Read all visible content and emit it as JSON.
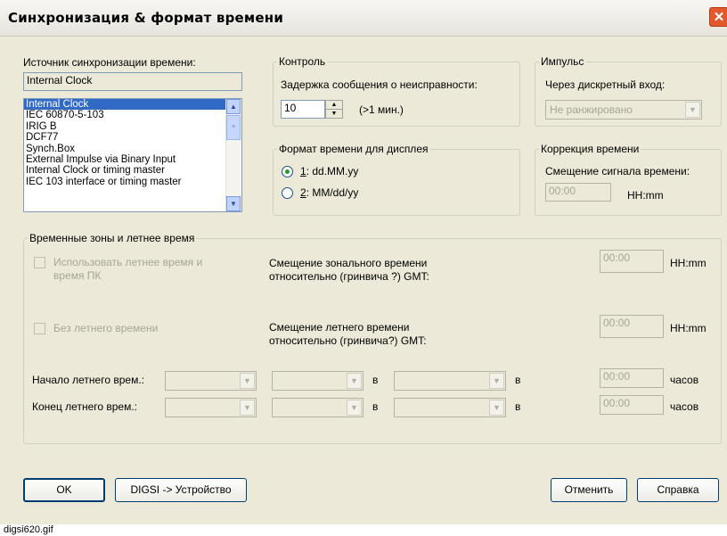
{
  "window": {
    "title": "Синхронизация & формат времени",
    "close_symbol": "✕"
  },
  "sync_source": {
    "label": "Источник синхронизации времени:",
    "current": "Internal Clock",
    "options": [
      "Internal Clock",
      "IEC 60870-5-103",
      "IRIG B",
      "DCF77",
      "Synch.Box",
      "External Impulse via Binary Input",
      "Internal Clock or timing master",
      "IEC 103 interface or timing master"
    ],
    "selected_index": 0
  },
  "control": {
    "legend": "Контроль",
    "delay_label": "Задержка сообщения о неисправности:",
    "delay_value": "10",
    "delay_unit": "(>1 мин.)"
  },
  "impulse": {
    "legend": "Импульс",
    "label": "Через дискретный вход:",
    "value": "Не ранжировано"
  },
  "display_format": {
    "legend": "Формат времени для дисплея",
    "options": [
      {
        "key": "1",
        "text": ": dd.MM.yy",
        "selected": true
      },
      {
        "key": "2",
        "text": ": MM/dd/yy",
        "selected": false
      }
    ]
  },
  "time_correction": {
    "legend": "Коррекция времени",
    "label": "Смещение сигнала времени:",
    "value": "00:00",
    "unit": "HH:mm"
  },
  "zones": {
    "legend": "Временные зоны и летнее время",
    "use_dst_line1": "Использовать летнее время и",
    "use_dst_line2": "время ПК",
    "no_dst": "Без летнего времени",
    "zone_offset_line1": "Смещение зонального времени",
    "zone_offset_line2": "относительно (гринвича ?) GMT:",
    "zone_offset_value": "00:00",
    "zone_offset_unit": "HH:mm",
    "dst_offset_line1": "Смещение летнего времени",
    "dst_offset_line2": "относительно (гринвича?) GMT:",
    "dst_offset_value": "00:00",
    "dst_offset_unit": "HH:mm",
    "start_label": "Начало летнего врем.:",
    "end_label": "Конец летнего врем.:",
    "at": "в",
    "start_time": "00:00",
    "end_time": "00:00",
    "hours_unit": "часов"
  },
  "buttons": {
    "ok": "OK",
    "digsi": "DIGSI -> Устройство",
    "cancel": "Отменить",
    "help": "Справка"
  },
  "caption": "digsi620.gif"
}
